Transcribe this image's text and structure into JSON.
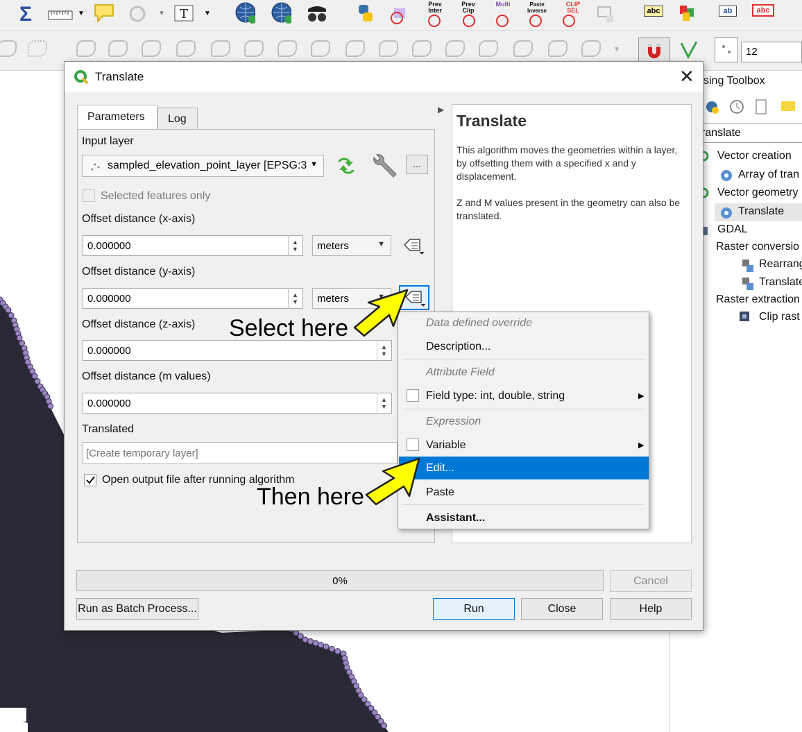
{
  "toolbar": {
    "icons_row1": [
      "sigma-icon",
      "measure-icon",
      "map-tips-icon",
      "identify-icon",
      "text-annotation-icon",
      "globe-add-icon",
      "globe-search-icon",
      "spy-glasses-icon",
      "python-icon",
      "selection-tool-icon"
    ],
    "prev_inter": "Prev Inter",
    "prev_clip": "Prev Clip",
    "multi": "Multi",
    "paste_inverse": "Paste Inverse",
    "clip_sel": "CLIP SEL",
    "label_abc": "abc",
    "label_ab": "ab",
    "font_size_value": "12"
  },
  "dialog": {
    "title": "Translate",
    "tabs": [
      "Parameters",
      "Log"
    ],
    "input_layer_label": "Input layer",
    "input_layer_value": "sampled_elevation_point_layer [EPSG:3",
    "selected_features_label": "Selected features only",
    "offset_x_label": "Offset distance (x-axis)",
    "offset_x_value": "0.000000",
    "offset_x_unit": "meters",
    "offset_y_label": "Offset distance (y-axis)",
    "offset_y_value": "0.000000",
    "offset_y_unit": "meters",
    "offset_z_label": "Offset distance (z-axis)",
    "offset_z_value": "0.000000",
    "offset_m_label": "Offset distance (m values)",
    "offset_m_value": "0.000000",
    "output_label": "Translated",
    "output_placeholder": "[Create temporary layer]",
    "open_output_label": "Open output file after running algorithm",
    "open_output_checked": true,
    "browse_label": "...",
    "progress_text": "0%",
    "progress": 0,
    "cancel_label": "Cancel",
    "batch_label": "Run as Batch Process...",
    "run_label": "Run",
    "close_label": "Close",
    "help_label": "Help",
    "help_panel": {
      "title": "Translate",
      "para1": "This algorithm moves the geometries within a layer, by offsetting them with a specified x and y displacement.",
      "para2": "Z and M values present in the geometry can also be translated."
    }
  },
  "context_menu": {
    "header_data_defined": "Data defined override",
    "description": "Description...",
    "header_attribute": "Attribute Field",
    "field_type": "Field type: int, double, string",
    "header_expression": "Expression",
    "variable": "Variable",
    "edit": "Edit...",
    "paste": "Paste",
    "assistant": "Assistant..."
  },
  "annotations": {
    "select_here": "Select here",
    "then_here": "Then here"
  },
  "toolbox": {
    "title": "ssing Toolbox",
    "search_value": "ranslate",
    "tree": [
      "Vector creation",
      "Array of tran",
      "Vector geometry",
      "Translate",
      "GDAL",
      "Raster conversio",
      "Rearrang",
      "Translate",
      "Raster extraction",
      "Clip rast"
    ]
  },
  "colors": {
    "selection_blue": "#0078d7",
    "arrow_yellow": "#ffff00",
    "map_fill": "#2b2835",
    "point_purple": "#9c86c3"
  }
}
